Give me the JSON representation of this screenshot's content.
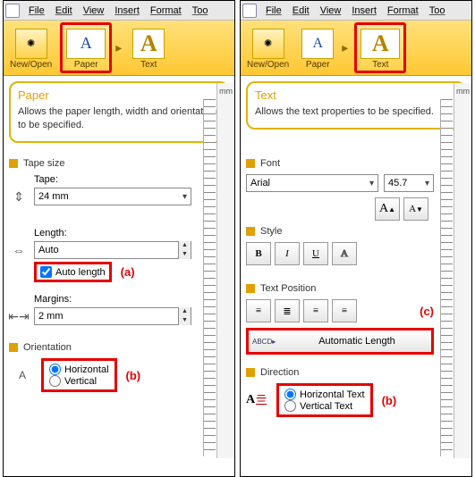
{
  "menu": {
    "file": "File",
    "edit": "Edit",
    "view": "View",
    "insert": "Insert",
    "format": "Format",
    "tools": "Too"
  },
  "ribbon": {
    "newopen": "New/Open",
    "paper": "Paper",
    "text": "Text"
  },
  "left": {
    "info_title": "Paper",
    "info_desc": "Allows the paper length, width and orientation to be specified.",
    "tape_size_hdr": "Tape size",
    "tape_lbl": "Tape:",
    "tape_val": "24 mm",
    "length_lbl": "Length:",
    "length_val": "Auto",
    "auto_len_chk": "Auto length",
    "note_a": "(a)",
    "margins_lbl": "Margins:",
    "margins_val": "2 mm",
    "orientation_hdr": "Orientation",
    "orient_h": "Horizontal",
    "orient_v": "Vertical",
    "note_b": "(b)"
  },
  "right": {
    "info_title": "Text",
    "info_desc": "Allows the text properties to be specified.",
    "font_hdr": "Font",
    "font_name": "Arial",
    "font_size": "45.7",
    "style_hdr": "Style",
    "pos_hdr": "Text Position",
    "note_c": "(c)",
    "autolen": "Automatic Length",
    "dir_hdr": "Direction",
    "dir_h": "Horizontal Text",
    "dir_v": "Vertical Text",
    "note_b": "(b)"
  },
  "unit": "mm"
}
